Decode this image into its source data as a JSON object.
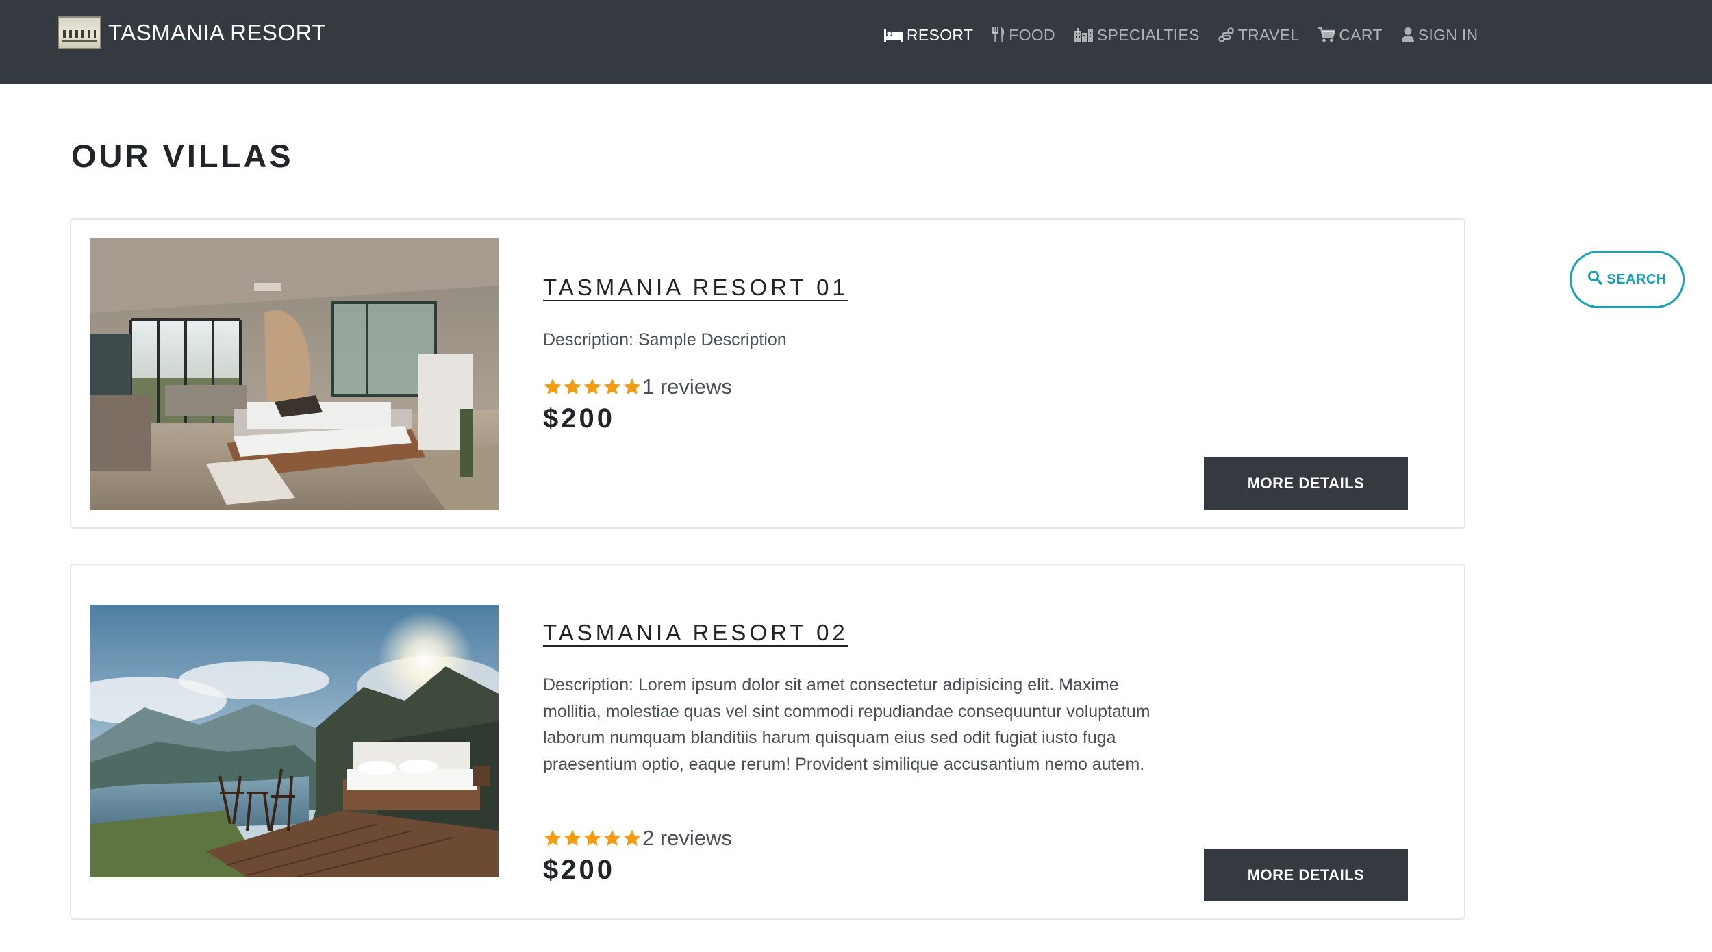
{
  "navbar": {
    "brand": "TASMANIA RESORT",
    "items": [
      {
        "label": "RESORT",
        "icon": "bed-icon",
        "active": true
      },
      {
        "label": "FOOD",
        "icon": "utensils-icon",
        "active": false
      },
      {
        "label": "SPECIALTIES",
        "icon": "city-icon",
        "active": false
      },
      {
        "label": "TRAVEL",
        "icon": "route-icon",
        "active": false
      },
      {
        "label": "CART",
        "icon": "cart-icon",
        "active": false
      },
      {
        "label": "SIGN IN",
        "icon": "user-icon",
        "active": false
      }
    ]
  },
  "page": {
    "title": "OUR VILLAS"
  },
  "search": {
    "label": "SEARCH",
    "icon": "search-icon"
  },
  "villas": [
    {
      "title": "TASMANIA RESORT 01",
      "description": "Description: Sample Description",
      "rating": 5,
      "reviews": "1 reviews",
      "price": "$200",
      "button": "MORE DETAILS",
      "image": "modern bedroom interior with glass shower and large windows"
    },
    {
      "title": "TASMANIA RESORT 02",
      "description": "Description: Lorem ipsum dolor sit amet consectetur adipisicing elit. Maxime mollitia, molestiae quas vel sint commodi repudiandae consequuntur voluptatum laborum numquam blanditiis harum quisquam eius sed odit fugiat iusto fuga praesentium optio, eaque rerum! Provident similique accusantium nemo autem.",
      "rating": 5,
      "reviews": "2 reviews",
      "price": "$200",
      "button": "MORE DETAILS",
      "image": "outdoor bed on wooden deck overlooking mountain lake"
    }
  ],
  "colors": {
    "navbar": "#343a40",
    "accent": "#17a2b8",
    "star": "#f39c12",
    "button": "#343a40"
  }
}
